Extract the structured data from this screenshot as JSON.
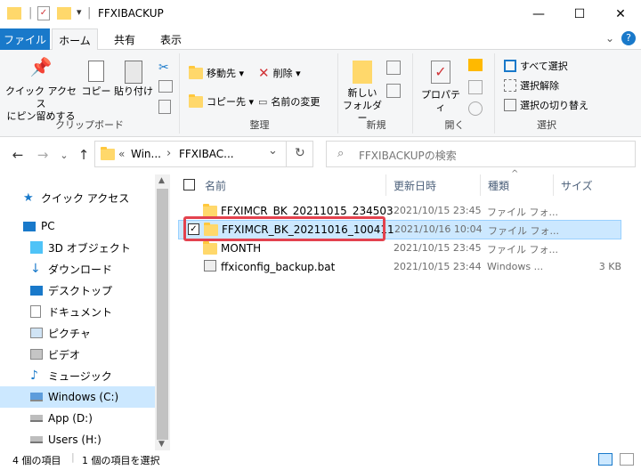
{
  "window": {
    "title": "FFXIBACKUP",
    "minimize": "—",
    "maximize": "☐",
    "close": "✕"
  },
  "tabs": {
    "file": "ファイル",
    "home": "ホーム",
    "share": "共有",
    "view": "表示"
  },
  "ribbon": {
    "clipboard": {
      "label": "クリップボード",
      "pin": "クイック アクセス\nにピン留めする",
      "copy": "コピー",
      "paste": "貼り付け"
    },
    "organize": {
      "label": "整理",
      "move_to": "移動先 ▾",
      "copy_to": "コピー先 ▾",
      "delete": "削除 ▾",
      "rename": "名前の変更"
    },
    "new": {
      "label": "新規",
      "new_folder": "新しい\nフォルダー"
    },
    "open": {
      "label": "開く",
      "properties": "プロパティ"
    },
    "select": {
      "label": "選択",
      "select_all": "すべて選択",
      "select_none": "選択解除",
      "invert": "選択の切り替え"
    }
  },
  "address": {
    "prefix": "«",
    "crumb1": "Win...",
    "sep": "›",
    "crumb2": "FFXIBAC...",
    "dropdown": "⌄",
    "refresh": "↻"
  },
  "search": {
    "placeholder": "FFXIBACKUPの検索"
  },
  "nav": {
    "back": "←",
    "forward": "→",
    "recent": "⌄",
    "up": "↑",
    "items": [
      {
        "label": "クイック アクセス"
      },
      {
        "label": "PC"
      },
      {
        "label": "3D オブジェクト"
      },
      {
        "label": "ダウンロード"
      },
      {
        "label": "デスクトップ"
      },
      {
        "label": "ドキュメント"
      },
      {
        "label": "ピクチャ"
      },
      {
        "label": "ビデオ"
      },
      {
        "label": "ミュージック"
      },
      {
        "label": "Windows (C:)"
      },
      {
        "label": "App (D:)"
      },
      {
        "label": "Users (H:)"
      }
    ]
  },
  "columns": {
    "name": "名前",
    "date": "更新日時",
    "type": "種類",
    "size": "サイズ"
  },
  "files": [
    {
      "name": "FFXIMCR_BK_20211015_234503",
      "date": "2021/10/15 23:45",
      "type": "ファイル フォ...",
      "size": ""
    },
    {
      "name": "FFXIMCR_BK_20211016_100411",
      "date": "2021/10/16 10:04",
      "type": "ファイル フォ...",
      "size": ""
    },
    {
      "name": "MONTH",
      "date": "2021/10/15 23:45",
      "type": "ファイル フォ...",
      "size": ""
    },
    {
      "name": "ffxiconfig_backup.bat",
      "date": "2021/10/15 23:44",
      "type": "Windows ...",
      "size": "3 KB"
    }
  ],
  "status": {
    "count": "4 個の項目",
    "selected": "1 個の項目を選択"
  },
  "colors": {
    "accent": "#1979ca",
    "selection": "#cce8ff",
    "highlight_box": "#e3424e"
  }
}
